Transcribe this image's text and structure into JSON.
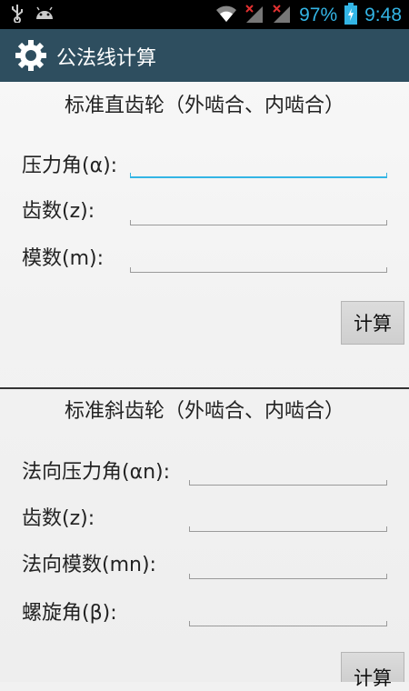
{
  "status_bar": {
    "battery_percent": "97%",
    "time": "9:48"
  },
  "app_bar": {
    "title": "公法线计算"
  },
  "spur": {
    "title": "标准直齿轮（外啮合、内啮合）",
    "labels": {
      "pressure_angle": "压力角(α):",
      "teeth": "齿数(z):",
      "module": "模数(m):"
    },
    "calc_label": "计算"
  },
  "helical": {
    "title": "标准斜齿轮（外啮合、内啮合）",
    "labels": {
      "normal_pressure_angle": "法向压力角(αn):",
      "teeth": "齿数(z):",
      "normal_module": "法向模数(mn):",
      "helix_angle": "螺旋角(β):"
    },
    "calc_label": "计算"
  },
  "colors": {
    "accent": "#33b5e5",
    "app_bar": "#2e4e5f"
  }
}
